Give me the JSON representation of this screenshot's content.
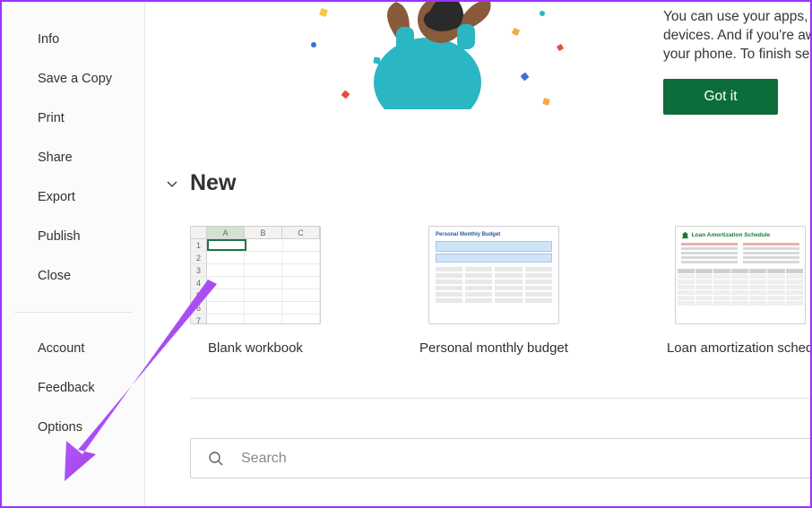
{
  "sidebar": {
    "items_top": [
      {
        "label": "Info"
      },
      {
        "label": "Save a Copy"
      },
      {
        "label": "Print"
      },
      {
        "label": "Share"
      },
      {
        "label": "Export"
      },
      {
        "label": "Publish"
      },
      {
        "label": "Close"
      }
    ],
    "items_bottom": [
      {
        "label": "Account"
      },
      {
        "label": "Feedback"
      },
      {
        "label": "Options"
      }
    ]
  },
  "banner": {
    "line1": "You can use your apps, access your work,",
    "line2": "devices. And if you're away from your des",
    "line3": "your phone. To finish setting up in your o",
    "button": "Got it"
  },
  "new_section": {
    "title": "New",
    "templates": [
      {
        "label": "Blank workbook"
      },
      {
        "label": "Personal monthly budget"
      },
      {
        "label": "Loan amortization sched"
      }
    ],
    "thumb_budget_title": "Personal Monthly Budget",
    "thumb_loan_title": "Loan Amortization Schedule"
  },
  "search": {
    "placeholder": "Search"
  },
  "colors": {
    "accent": "#0d6d3a",
    "annotation": "#9b33ff"
  }
}
